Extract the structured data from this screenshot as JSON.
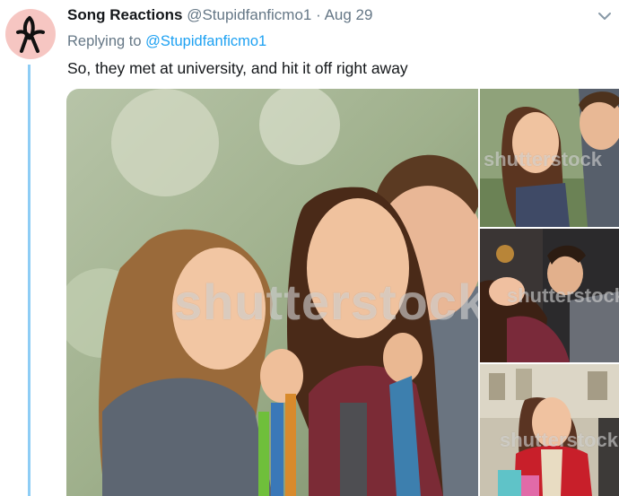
{
  "tweet": {
    "display_name": "Song Reactions",
    "handle": "@Stupidfanficmo1",
    "separator": "·",
    "date": "Aug 29",
    "replying_prefix": "Replying to",
    "replying_to": "@Stupidfanficmo1",
    "text": "So, they met at university, and hit it off right away"
  },
  "media": {
    "watermark": "shutterstock",
    "photos": [
      {
        "name": "main-photo",
        "description_icon": "image"
      },
      {
        "name": "thumb-photo-1",
        "description_icon": "image"
      },
      {
        "name": "thumb-photo-2",
        "description_icon": "image"
      },
      {
        "name": "thumb-photo-3",
        "description_icon": "image"
      }
    ]
  },
  "colors": {
    "link": "#1da1f2",
    "secondary_text": "#657786",
    "thread_line": "#8ecdf5",
    "avatar_bg": "#f6c6c2"
  }
}
